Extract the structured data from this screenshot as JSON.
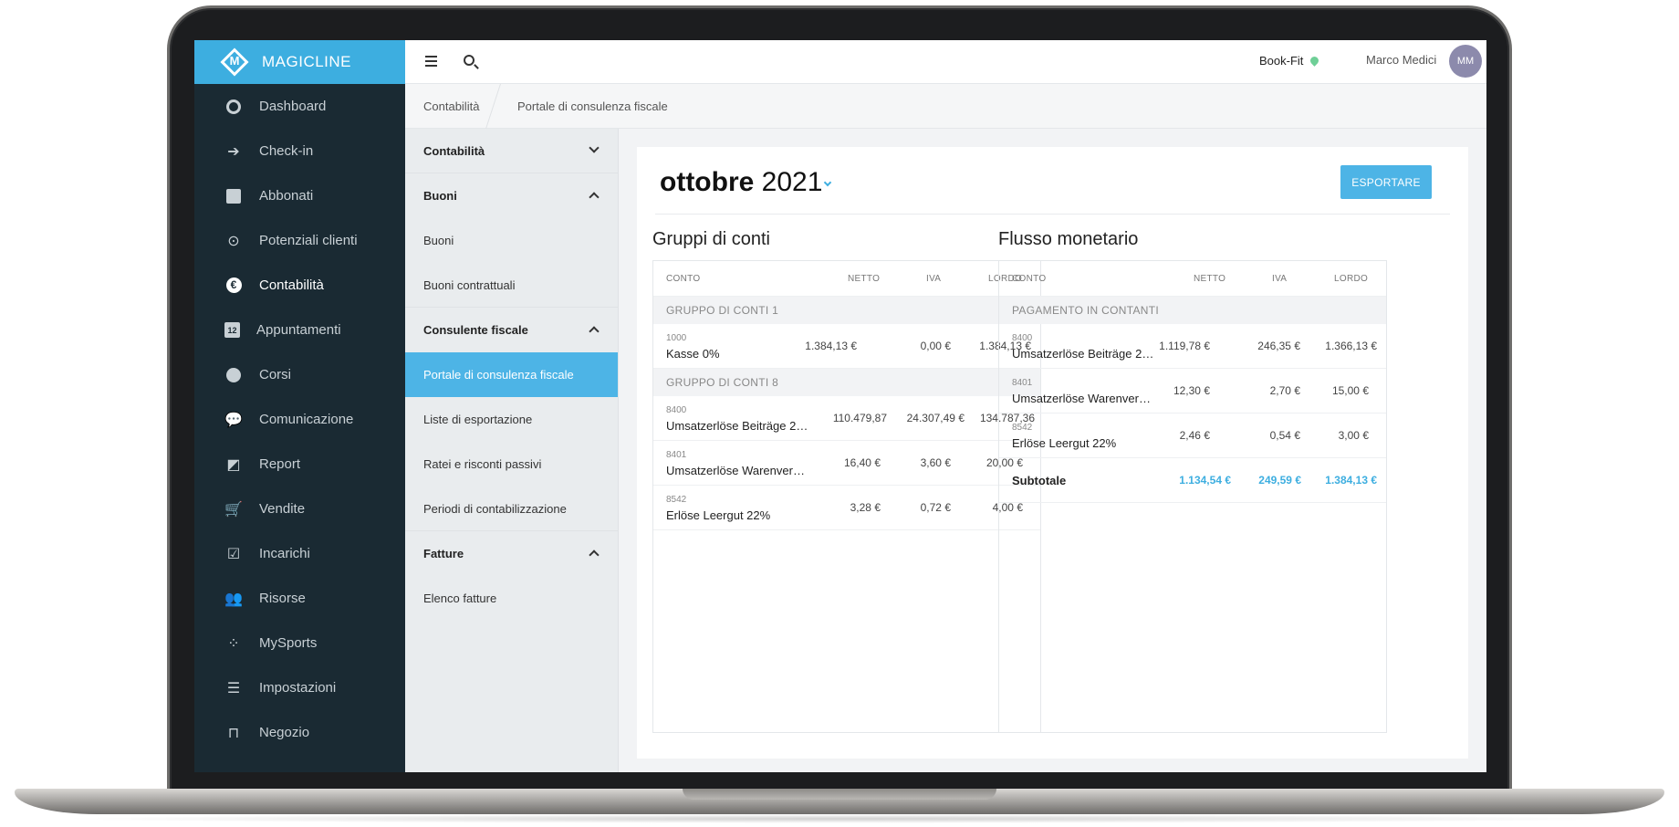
{
  "brand": {
    "name": "MAGICLINE",
    "logo_letter": "M",
    "color": "#3daee0"
  },
  "sidebar": {
    "items": [
      {
        "label": "Dashboard",
        "icon": "dashboard-icon"
      },
      {
        "label": "Check-in",
        "icon": "check-in-icon"
      },
      {
        "label": "Abbonati",
        "icon": "members-icon"
      },
      {
        "label": "Potenziali clienti",
        "icon": "leads-icon"
      },
      {
        "label": "Contabilità",
        "icon": "euro-icon",
        "active": true
      },
      {
        "label": "Appuntamenti",
        "icon": "calendar-icon",
        "icon_text": "12"
      },
      {
        "label": "Corsi",
        "icon": "stopwatch-icon"
      },
      {
        "label": "Comunicazione",
        "icon": "chat-icon"
      },
      {
        "label": "Report",
        "icon": "chart-icon"
      },
      {
        "label": "Vendite",
        "icon": "cart-icon"
      },
      {
        "label": "Incarichi",
        "icon": "checkbox-icon"
      },
      {
        "label": "Risorse",
        "icon": "people-icon"
      },
      {
        "label": "MySports",
        "icon": "mysports-icon"
      },
      {
        "label": "Impostazioni",
        "icon": "sliders-icon"
      },
      {
        "label": "Negozio",
        "icon": "shop-icon"
      }
    ]
  },
  "topbar": {
    "location": "Book-Fit",
    "user_name": "Marco Medici",
    "avatar_initials": "MM"
  },
  "breadcrumb": {
    "level1": "Contabilità",
    "level2": "Portale di consulenza fiscale"
  },
  "subnav": {
    "sections": [
      {
        "title": "Contabilità",
        "expanded": false,
        "items": []
      },
      {
        "title": "Buoni",
        "expanded": true,
        "items": [
          "Buoni",
          "Buoni contrattuali"
        ]
      },
      {
        "title": "Consulente fiscale",
        "expanded": true,
        "items": [
          "Portale di consulenza fiscale",
          "Liste di esportazione",
          "Ratei e risconti passivi",
          "Periodi di contabilizzazione"
        ],
        "active_item": "Portale di consulenza fiscale"
      },
      {
        "title": "Fatture",
        "expanded": true,
        "items": [
          "Elenco fatture"
        ]
      }
    ]
  },
  "period": {
    "month": "ottobre",
    "year": "2021"
  },
  "export_label": "ESPORTARE",
  "columns": {
    "account": "CONTO",
    "net": "NETTO",
    "vat": "IVA",
    "gross": "LORDO"
  },
  "account_groups": {
    "title": "Gruppi di conti",
    "groups": [
      {
        "name": "GRUPPO DI CONTI 1",
        "rows": [
          {
            "code": "1000",
            "name": "Kasse 0%",
            "net": "1.384,13 €",
            "vat": "0,00 €",
            "gross": "1.384,13 €"
          }
        ]
      },
      {
        "name": "GRUPPO DI CONTI 8",
        "rows": [
          {
            "code": "8400",
            "name": "Umsatzerlöse Beiträge 2…",
            "net": "110.479,87",
            "vat": "24.307,49 €",
            "gross": "134.787,36"
          },
          {
            "code": "8401",
            "name": "Umsatzerlöse Warenver…",
            "net": "16,40 €",
            "vat": "3,60 €",
            "gross": "20,00 €"
          },
          {
            "code": "8542",
            "name": "Erlöse Leergut 22%",
            "net": "3,28 €",
            "vat": "0,72 €",
            "gross": "4,00 €"
          }
        ]
      }
    ]
  },
  "cash_flow": {
    "title": "Flusso monetario",
    "group": "PAGAMENTO IN CONTANTI",
    "rows": [
      {
        "code": "8400",
        "name": "Umsatzerlöse Beiträge 2…",
        "net": "1.119,78 €",
        "vat": "246,35 €",
        "gross": "1.366,13 €"
      },
      {
        "code": "8401",
        "name": "Umsatzerlöse Warenver…",
        "net": "12,30 €",
        "vat": "2,70 €",
        "gross": "15,00 €"
      },
      {
        "code": "8542",
        "name": "Erlöse Leergut 22%",
        "net": "2,46 €",
        "vat": "0,54 €",
        "gross": "3,00 €"
      }
    ],
    "subtotal": {
      "label": "Subtotale",
      "net": "1.134,54 €",
      "vat": "249,59 €",
      "gross": "1.384,13 €"
    }
  }
}
